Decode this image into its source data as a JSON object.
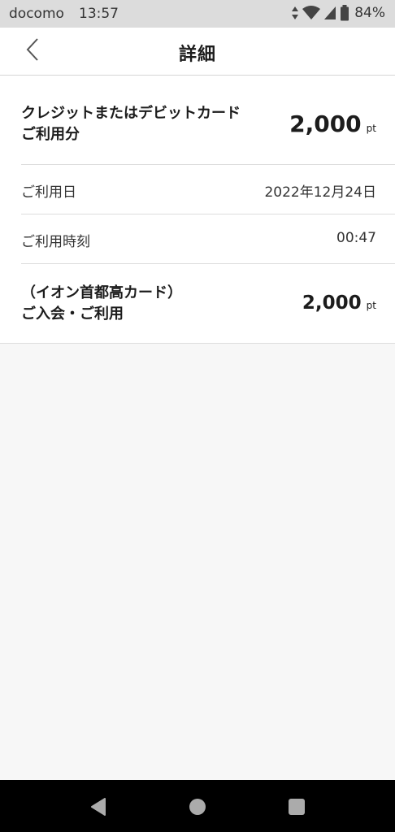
{
  "status_bar": {
    "carrier": "docomo",
    "time": "13:57",
    "battery": "84%"
  },
  "header": {
    "title": "詳細",
    "back_icon": "chevron-left-icon"
  },
  "detail": {
    "main": {
      "label_line1": "クレジットまたはデビットカード",
      "label_line2": "ご利用分",
      "amount": "2,000",
      "unit": "pt"
    },
    "date": {
      "label": "ご利用日",
      "value": "2022年12月24日"
    },
    "time": {
      "label": "ご利用時刻",
      "value": "00:47"
    },
    "item": {
      "label_line1": "（イオン首都高カード）",
      "label_line2": "ご入会・ご利用",
      "amount": "2,000",
      "unit": "pt"
    }
  },
  "nav_bar": {
    "icons": [
      "back-triangle-icon",
      "home-circle-icon",
      "recents-square-icon"
    ]
  }
}
